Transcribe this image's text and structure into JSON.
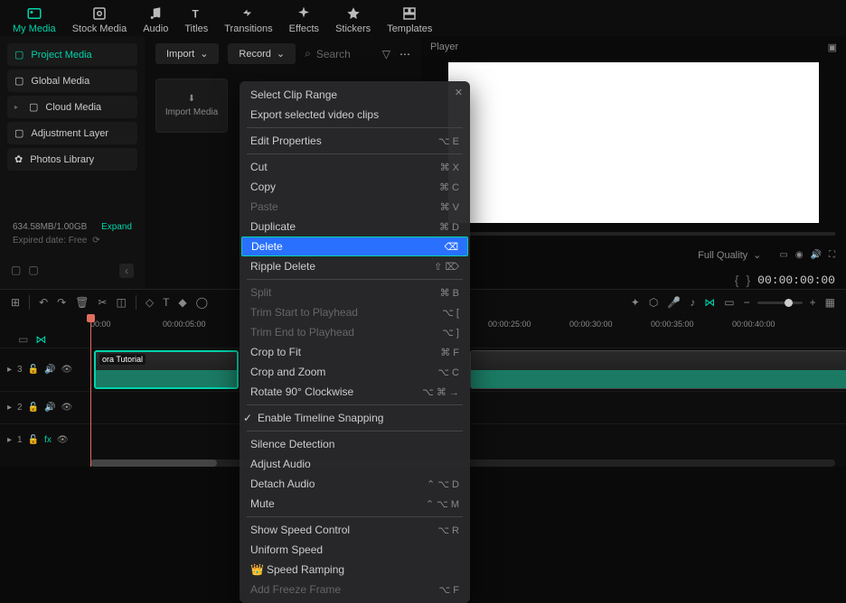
{
  "tabs": {
    "my_media": "My Media",
    "stock_media": "Stock Media",
    "audio": "Audio",
    "titles": "Titles",
    "transitions": "Transitions",
    "effects": "Effects",
    "stickers": "Stickers",
    "templates": "Templates"
  },
  "sidebar": {
    "project_media": "Project Media",
    "global_media": "Global Media",
    "cloud_media": "Cloud Media",
    "adjustment_layer": "Adjustment Layer",
    "photos_library": "Photos Library",
    "storage": "634.58MB/1.00GB",
    "expand": "Expand",
    "expired": "Expired date: Free"
  },
  "center": {
    "import": "Import",
    "record": "Record",
    "search": "Search",
    "import_media": "Import Media"
  },
  "player": {
    "title": "Player",
    "quality": "Full Quality",
    "timecode": "00:00:00:00"
  },
  "ruler": [
    "00:00",
    "00:00:05:00",
    "00:00:25:00",
    "00:00:30:00",
    "00:00:35:00",
    "00:00:40:00"
  ],
  "tracks": {
    "t3": "3",
    "t2": "2",
    "t1": "1"
  },
  "clip": {
    "label": "ora Tutorial"
  },
  "context_menu": {
    "select_clip_range": "Select Clip Range",
    "export_selected": "Export selected video clips",
    "edit_properties": "Edit Properties",
    "cut": "Cut",
    "copy": "Copy",
    "paste": "Paste",
    "duplicate": "Duplicate",
    "delete": "Delete",
    "ripple_delete": "Ripple Delete",
    "split": "Split",
    "trim_start": "Trim Start to Playhead",
    "trim_end": "Trim End to Playhead",
    "crop_to_fit": "Crop to Fit",
    "crop_zoom": "Crop and Zoom",
    "rotate_90": "Rotate 90° Clockwise",
    "enable_snap": "Enable Timeline Snapping",
    "silence_detection": "Silence Detection",
    "adjust_audio": "Adjust Audio",
    "detach_audio": "Detach Audio",
    "mute": "Mute",
    "show_speed": "Show Speed Control",
    "uniform_speed": "Uniform Speed",
    "speed_ramping": "Speed Ramping",
    "add_freeze": "Add Freeze Frame",
    "sc": {
      "edit_properties": "⌥ E",
      "cut": "⌘ X",
      "copy": "⌘ C",
      "paste": "⌘ V",
      "duplicate": "⌘ D",
      "ripple_delete": "⇧ ⌦",
      "split": "⌘ B",
      "trim_start": "⌥ [",
      "trim_end": "⌥ ]",
      "crop_to_fit": "⌘ F",
      "crop_zoom": "⌥ C",
      "rotate_90": "⌥ ⌘ →",
      "detach_audio": "⌃ ⌥ D",
      "mute": "⌃ ⌥ M",
      "show_speed": "⌥ R",
      "add_freeze": "⌥ F"
    }
  }
}
